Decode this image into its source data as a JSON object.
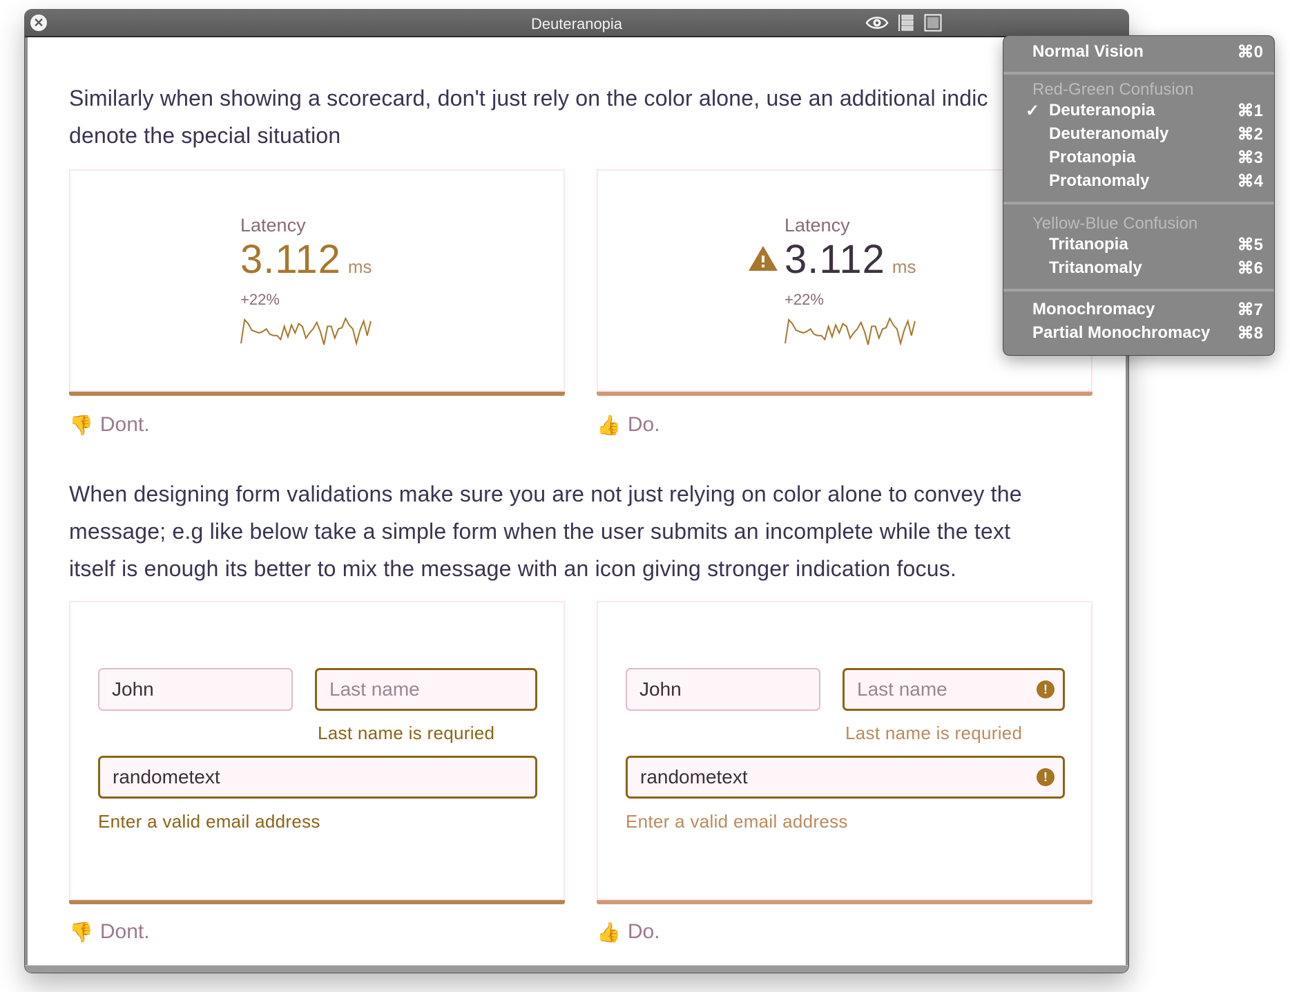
{
  "window": {
    "title": "Deuteranopia",
    "close_icon": "close-circle-icon",
    "toolbar_icons": [
      "eye-icon",
      "list-view-icon",
      "square-view-icon"
    ]
  },
  "content": {
    "paragraph1": {
      "line1": "Similarly when showing a scorecard, don't just rely on the color alone, use an additional indic",
      "line2": "denote the special situation"
    },
    "scorecards": [
      {
        "label": "Latency",
        "value": "3.112",
        "unit": "ms",
        "change": "+22%",
        "has_warning_icon": false,
        "value_color": "#a8772c",
        "accent_color": "#b48553",
        "verdict": "Dont.",
        "verdict_icon": "thumbs-down-icon"
      },
      {
        "label": "Latency",
        "value": "3.112",
        "unit": "ms",
        "change": "+22%",
        "has_warning_icon": true,
        "value_color": "#3d3340",
        "accent_color": "#cc9a76",
        "verdict": "Do.",
        "verdict_icon": "thumbs-up-icon"
      }
    ],
    "sparkline": [
      0.05,
      0.95,
      0.8,
      0.55,
      0.5,
      0.45,
      0.5,
      0.6,
      0.4,
      0.35,
      0.35,
      0.2,
      0.7,
      0.3,
      0.75,
      0.45,
      0.8,
      0.7,
      0.25,
      0.45,
      0.6,
      0.85,
      0.5,
      0.0,
      0.7,
      0.7,
      0.25,
      0.6,
      0.65,
      1.0,
      0.75,
      0.6,
      0.05,
      0.55,
      0.9,
      0.35,
      0.9
    ],
    "sparkline_color": "#a8772c",
    "paragraph2": {
      "line1": "When designing form validations make sure you are not just relying on color alone to convey the",
      "line2": "message; e.g like below take a simple form when the user submits an incomplete while the text",
      "line3": "itself is enough its better to mix the message with an icon giving stronger indication focus."
    },
    "forms": [
      {
        "first_name_value": "John",
        "last_name_placeholder": "Last name",
        "last_name_error": "Last name is requried",
        "email_value": "randometext",
        "email_error": "Enter a valid email address",
        "error_color": "#8d6317",
        "show_alert_icons": false,
        "accent_color": "#b48553",
        "verdict": "Dont.",
        "verdict_icon": "thumbs-down-icon"
      },
      {
        "first_name_value": "John",
        "last_name_placeholder": "Last name",
        "last_name_error": "Last name is requried",
        "email_value": "randometext",
        "email_error": "Enter a valid email address",
        "error_color": "#bb8a5e",
        "show_alert_icons": true,
        "accent_color": "#cc9a76",
        "verdict": "Do.",
        "verdict_icon": "thumbs-up-icon"
      }
    ]
  },
  "menu": {
    "items": [
      {
        "label": "Normal Vision",
        "shortcut": "⌘0"
      },
      {
        "header": "Red-Green Confusion"
      },
      {
        "label": "Deuteranopia",
        "shortcut": "⌘1",
        "checked": true
      },
      {
        "label": "Deuteranomaly",
        "shortcut": "⌘2"
      },
      {
        "label": "Protanopia",
        "shortcut": "⌘3"
      },
      {
        "label": "Protanomaly",
        "shortcut": "⌘4"
      },
      {
        "header": "Yellow-Blue Confusion"
      },
      {
        "label": "Tritanopia",
        "shortcut": "⌘5"
      },
      {
        "label": "Tritanomaly",
        "shortcut": "⌘6"
      },
      {
        "label": "Monochromacy",
        "shortcut": "⌘7"
      },
      {
        "label": "Partial Monochromacy",
        "shortcut": "⌘8"
      }
    ],
    "check_glyph": "✓"
  }
}
